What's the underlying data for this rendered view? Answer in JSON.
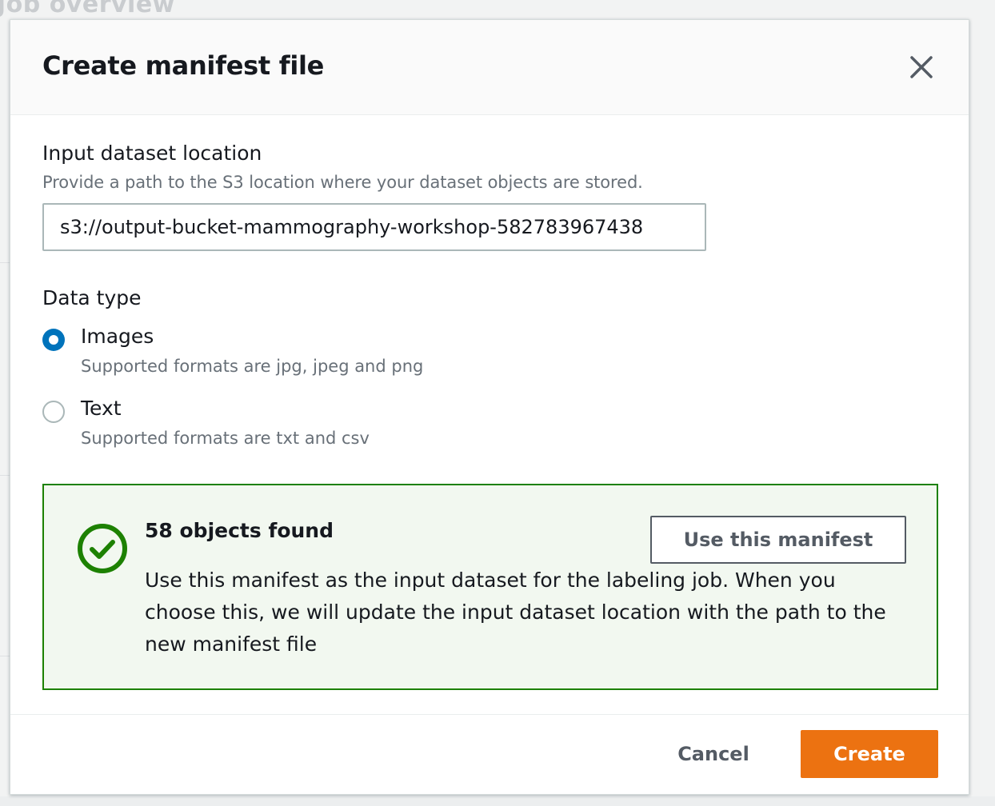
{
  "background": {
    "page_title": "Job overview"
  },
  "modal": {
    "title": "Create manifest file",
    "close_icon": "close-icon",
    "input_dataset": {
      "label": "Input dataset location",
      "description": "Provide a path to the S3 location where your dataset objects are stored.",
      "value": "s3://output-bucket-mammography-workshop-582783967438"
    },
    "data_type": {
      "label": "Data type",
      "options": [
        {
          "label": "Images",
          "description": "Supported formats are jpg, jpeg and png",
          "selected": true
        },
        {
          "label": "Text",
          "description": "Supported formats are txt and csv",
          "selected": false
        }
      ]
    },
    "alert": {
      "icon": "check-circle-icon",
      "title": "58 objects found",
      "body": "Use this manifest as the input dataset for the labeling job. When you choose this, we will update the input dataset location with the path to the new manifest file",
      "button_label": "Use this manifest"
    },
    "footer": {
      "cancel_label": "Cancel",
      "create_label": "Create"
    }
  },
  "colors": {
    "primary_button": "#ec7211",
    "radio_selected": "#0073bb",
    "success": "#1d8102",
    "success_bg": "#f2f8f0",
    "text": "#16191f",
    "secondary_text": "#687078"
  }
}
